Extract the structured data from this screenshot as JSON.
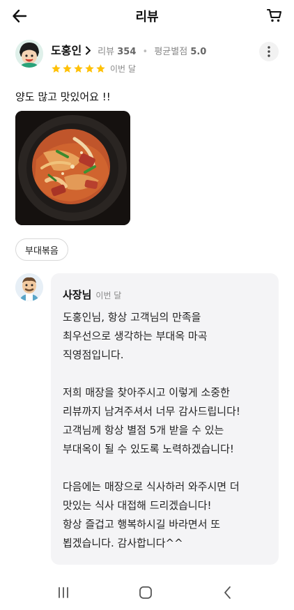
{
  "header": {
    "title": "리뷰",
    "back_icon": "arrow-left-icon",
    "cart_icon": "cart-icon"
  },
  "review": {
    "user_name": "도홍인",
    "review_label": "리뷰",
    "review_count": "354",
    "avg_label": "평균별점",
    "avg_rating": "5.0",
    "rating": 5,
    "date": "이번 달",
    "text": "양도 많고 맛있어요 !!",
    "menu_chip": "부대볶음"
  },
  "reply": {
    "owner_name": "사장님",
    "date": "이번 달",
    "lines": [
      "도홍인님,  항상 고객님의 만족을",
      "최우선으로 생각하는 부대옥 마곡",
      "직영점입니다.",
      "",
      "저희 매장을 찾아주시고 이렇게 소중한",
      "리뷰까지 남겨주셔서 너무 감사드립니다!",
      "고객님께 항상 별점 5개 받을 수 있는",
      "부대옥이 될 수 있도록 노력하겠습니다!",
      "",
      "다음에는 매장으로 식사하러 와주시면 더",
      "맛있는 식사 대접해 드리겠습니다!",
      "항상 즐겁고 행복하시길 바라면서 또",
      "뵙겠습니다. 감사합니다^^"
    ]
  },
  "colors": {
    "star": "#FFC107",
    "reply_bg": "#F4F4F6",
    "meta_text": "#888888"
  },
  "navbar": {
    "recents_icon": "recent-apps-icon",
    "home_icon": "home-icon",
    "back_icon": "nav-back-icon"
  }
}
